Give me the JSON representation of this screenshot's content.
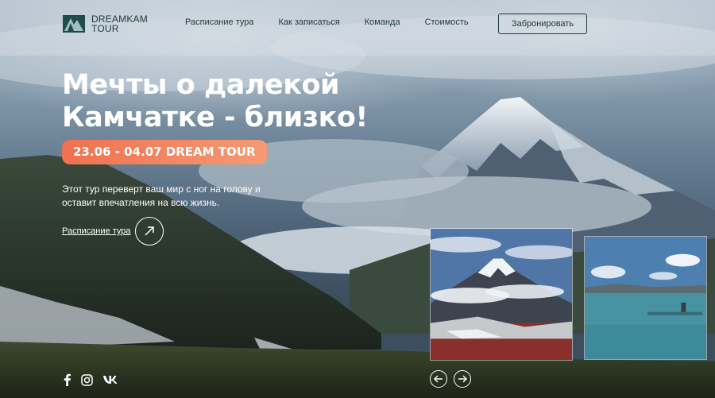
{
  "brand": {
    "line1": "DREAMKAM",
    "line2": "TOUR",
    "accent": "#1f3b3a"
  },
  "nav": {
    "items": [
      {
        "label": "Расписание тура"
      },
      {
        "label": "Как записаться"
      },
      {
        "label": "Команда"
      },
      {
        "label": "Стоимость"
      }
    ],
    "cta": "Забронировать"
  },
  "hero": {
    "title_line1": "Мечты о далекой",
    "title_line2": "Камчатке - близко!",
    "dates": "23.06 - 04.07 DREAM TOUR",
    "desc_line1": "Этот тур переверт ваш мир с ног на голову и",
    "desc_line2": "оставит впечатления на всю жизнь.",
    "schedule_link": "Расписание тура",
    "badge_color": "#f0714f"
  },
  "gallery": {
    "cards": [
      {
        "icon": "volcano-photo"
      },
      {
        "icon": "bay-photo"
      }
    ]
  },
  "slider": {
    "prev_icon": "arrow-left-icon",
    "next_icon": "arrow-right-icon"
  },
  "socials": [
    "facebook-icon",
    "instagram-icon",
    "vk-icon"
  ]
}
